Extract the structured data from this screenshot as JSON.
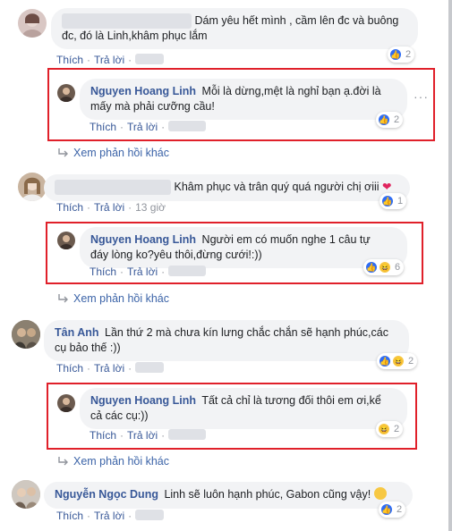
{
  "colors": {
    "link": "#385898",
    "bubble": "#f2f3f5",
    "highlight": "#e0202a"
  },
  "actions": {
    "like": "Thích",
    "reply": "Trả lời",
    "separator": "·"
  },
  "comments": [
    {
      "text": "Dám yêu hết mình , cầm lên đc và buông đc, đó là Linh,khâm phục lắm",
      "text_line1": "Dám yêu hết mình , cầm lên đc và buông",
      "text_line2": "đc, đó là Linh,khâm phục lắm",
      "reactions": {
        "icons": [
          "like-icon"
        ],
        "count": "2"
      },
      "reply": {
        "author": "Nguyen Hoang Linh",
        "text_line1": "Mỗi là dừng,mệt là nghỉ bạn ạ.đời là",
        "text_line2": "mấy mà phải cưỡng cầu!",
        "reactions": {
          "icons": [
            "like-icon"
          ],
          "count": "2"
        }
      }
    },
    {
      "text": "Khâm phục và trân quý quá người chị ơiii",
      "time": "13 giờ",
      "reactions": {
        "icons": [
          "like-icon"
        ],
        "count": "1"
      },
      "reply": {
        "author": "Nguyen Hoang Linh",
        "text_line1": "Người em có muốn nghe 1 câu tự",
        "text_line2": "đáy lòng ko?yêu thôi,đừng cưới!:))",
        "reactions": {
          "icons": [
            "like-icon",
            "haha-icon"
          ],
          "count": "6"
        }
      }
    },
    {
      "author": "Tân Anh",
      "text_line1": "Lần thứ 2 mà chưa kín lưng chắc chắn sẽ hạnh phúc,các",
      "text_line2": "cụ bảo thế :))",
      "reactions": {
        "icons": [
          "like-icon",
          "haha-icon"
        ],
        "count": "2"
      },
      "reply": {
        "author": "Nguyen Hoang Linh",
        "text_line1": "Tất cả chỉ là tương đối thôi em ơi,kể",
        "text_line2": "cả các cụ:))",
        "reactions": {
          "icons": [
            "haha-icon"
          ],
          "count": "2"
        }
      }
    },
    {
      "author": "Nguyễn Ngọc Dung",
      "text": "Linh sẽ luôn hạnh phúc, Gabon cũng vậy!",
      "reactions": {
        "icons": [
          "like-icon"
        ],
        "count": "2"
      }
    }
  ],
  "view_more_replies": "Xem phản hồi khác"
}
